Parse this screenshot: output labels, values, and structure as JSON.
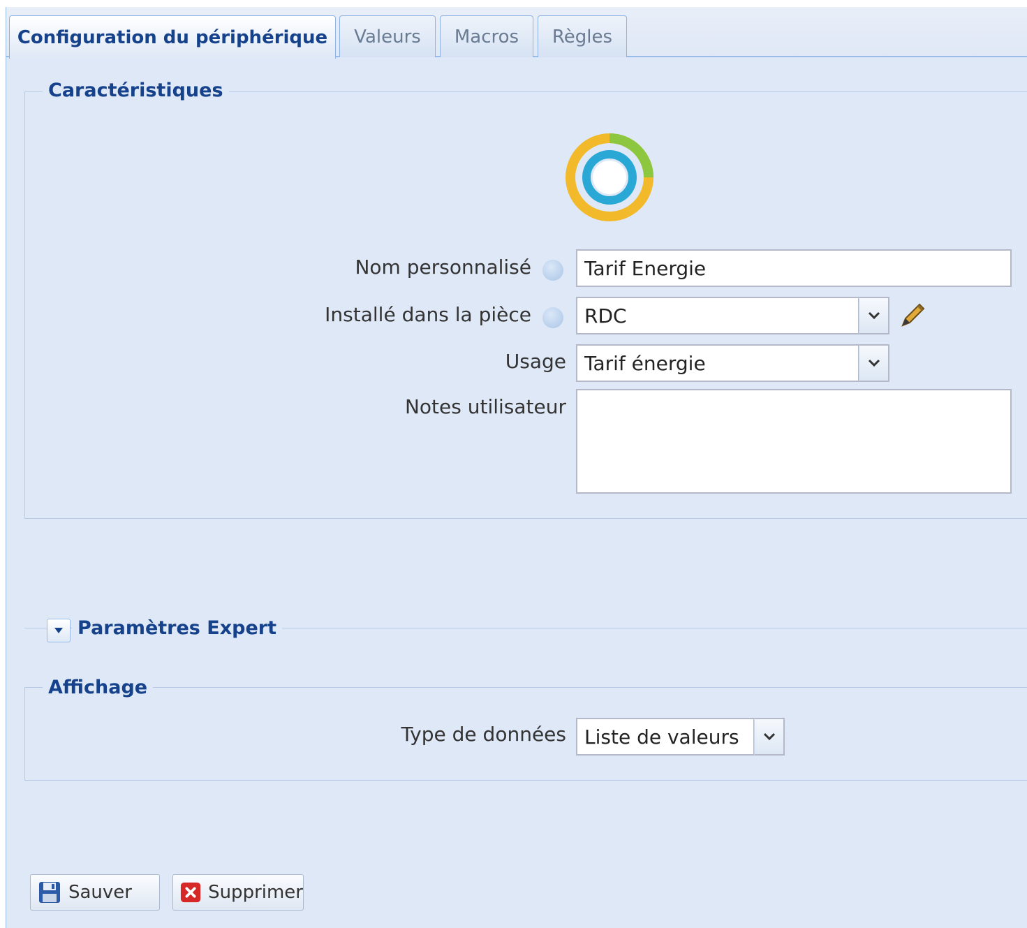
{
  "tabs": [
    {
      "label": "Configuration du périphérique",
      "active": true
    },
    {
      "label": "Valeurs",
      "active": false
    },
    {
      "label": "Macros",
      "active": false
    },
    {
      "label": "Règles",
      "active": false
    }
  ],
  "characteristics": {
    "title": "Caractéristiques",
    "device_icon": "energy-tariff-ring-icon",
    "fields": {
      "custom_name": {
        "label": "Nom personnalisé",
        "value": "Tarif Energie"
      },
      "room": {
        "label": "Installé dans la pièce",
        "value": "RDC"
      },
      "usage": {
        "label": "Usage",
        "value": "Tarif énergie"
      },
      "notes": {
        "label": "Notes utilisateur",
        "value": ""
      }
    }
  },
  "expert": {
    "label": "Paramètres Expert"
  },
  "display": {
    "title": "Affichage",
    "data_type": {
      "label": "Type de données",
      "value": "Liste de valeurs"
    }
  },
  "buttons": {
    "save": "Sauver",
    "delete": "Supprimer"
  },
  "colors": {
    "accent": "#15428b",
    "ring_outer": "#f2b92a",
    "ring_green": "#8dc63f",
    "ring_inner": "#29a8d6"
  }
}
